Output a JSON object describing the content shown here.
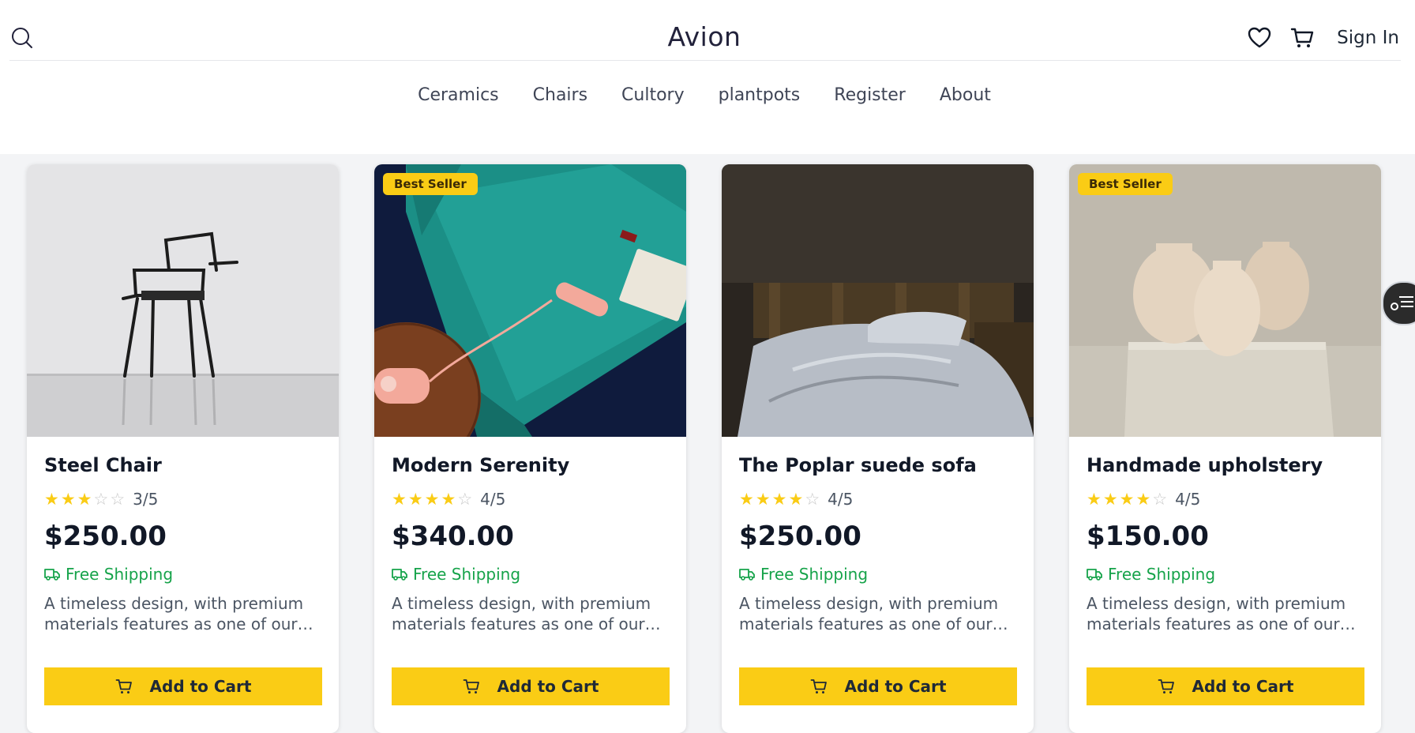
{
  "header": {
    "brand": "Avion",
    "signin_label": "Sign In",
    "icons": {
      "search": "search-icon",
      "wishlist": "heart-icon",
      "cart": "cart-icon"
    }
  },
  "nav": {
    "items": [
      {
        "label": "Ceramics"
      },
      {
        "label": "Chairs"
      },
      {
        "label": "Cultory"
      },
      {
        "label": "plantpots"
      },
      {
        "label": "Register"
      },
      {
        "label": "About"
      }
    ]
  },
  "products": [
    {
      "title": "Steel Chair",
      "rating": 3,
      "rating_max": 5,
      "rating_text": "3/5",
      "price": "$250.00",
      "shipping": "Free Shipping",
      "description": "A timeless design, with premium materials features as one of our most popular products",
      "badge": "",
      "button_label": "Add to Cart"
    },
    {
      "title": "Modern Serenity",
      "rating": 4,
      "rating_max": 5,
      "rating_text": "4/5",
      "price": "$340.00",
      "shipping": "Free Shipping",
      "description": "A timeless design, with premium materials features as one of our most popular products",
      "badge": "Best Seller",
      "button_label": "Add to Cart"
    },
    {
      "title": "The Poplar suede sofa",
      "rating": 4,
      "rating_max": 5,
      "rating_text": "4/5",
      "price": "$250.00",
      "shipping": "Free Shipping",
      "description": "A timeless design, with premium materials features as one of our most popular products",
      "badge": "",
      "button_label": "Add to Cart"
    },
    {
      "title": "Handmade upholstery",
      "rating": 4,
      "rating_max": 5,
      "rating_text": "4/5",
      "price": "$150.00",
      "shipping": "Free Shipping",
      "description": "A timeless design, with premium materials features as one of our most popular products",
      "badge": "Best Seller",
      "button_label": "Add to Cart"
    }
  ],
  "colors": {
    "accent": "#facc15",
    "shipping": "#16a34a",
    "brand_text": "#22223b"
  }
}
